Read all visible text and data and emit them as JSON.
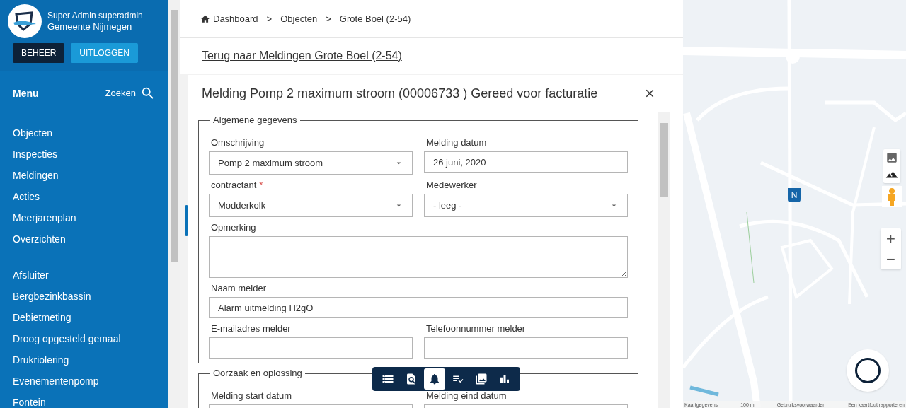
{
  "user": {
    "name": "Super Admin superadmin",
    "organisation": "Gemeente Nijmegen"
  },
  "header_buttons": [
    {
      "label": "BEHEER",
      "kind": "dark"
    },
    {
      "label": "UITLOGGEN",
      "kind": "light"
    }
  ],
  "menu": {
    "title": "Menu",
    "search_label": "Zoeken"
  },
  "nav_groups": [
    [
      "Objecten",
      "Inspecties",
      "Meldingen",
      "Acties",
      "Meerjarenplan",
      "Overzichten"
    ],
    [
      "Afsluiter",
      "Bergbezinkbassin",
      "Debietmeting",
      "Droog opgesteld gemaal",
      "Drukriolering",
      "Evenementenpomp",
      "Fontein"
    ]
  ],
  "breadcrumb": {
    "separator": ">",
    "items": [
      {
        "label": "Dashboard",
        "kind": "home-link"
      },
      {
        "label": "Objecten",
        "kind": "link"
      },
      {
        "label": "Grote Boel (2-54)",
        "kind": "current"
      }
    ]
  },
  "back_link": "Terug naar Meldingen Grote Boel (2-54)",
  "dialog": {
    "title": "Melding Pomp 2 maximum stroom (00006733 ) Gereed voor facturatie"
  },
  "sections": [
    {
      "legend": "Algemene gegevens",
      "fields": [
        {
          "label": "Omschrijving",
          "kind": "select",
          "value": "Pomp 2 maximum stroom",
          "wide": false
        },
        {
          "label": "Melding datum",
          "kind": "text",
          "value": "26 juni, 2020",
          "wide": false
        },
        {
          "label": "contractant",
          "required_mark": "*",
          "kind": "select",
          "value": "Modderkolk",
          "wide": false
        },
        {
          "label": "Medewerker",
          "kind": "select",
          "value": "- leeg -",
          "wide": false
        },
        {
          "label": "Opmerking",
          "kind": "textarea",
          "wide": true
        },
        {
          "label": "Naam melder",
          "kind": "text",
          "value": "Alarm uitmelding H2gO",
          "wide": true
        },
        {
          "label": "E-mailadres melder",
          "kind": "text",
          "wide": false
        },
        {
          "label": "Telefoonnummer melder",
          "kind": "text",
          "wide": false
        }
      ]
    },
    {
      "legend": "Oorzaak en oplossing",
      "fields": [
        {
          "label": "Melding start datum",
          "kind": "text",
          "wide": false
        },
        {
          "label": "Melding eind datum",
          "kind": "text",
          "wide": false
        }
      ]
    }
  ],
  "toolbar": [
    {
      "kind": "records",
      "selected": false
    },
    {
      "kind": "inspect",
      "selected": false
    },
    {
      "kind": "notifications",
      "selected": true
    },
    {
      "kind": "checklist",
      "selected": false
    },
    {
      "kind": "photos",
      "selected": false
    },
    {
      "kind": "chart",
      "selected": false
    }
  ],
  "map": {
    "marker_label": "N",
    "zoom_in": "+",
    "zoom_out": "−",
    "attribution": [
      "Kaartgegevens",
      "100 m",
      "Gebruiksvoorwaarden",
      "Een kaartfout rapporteren"
    ]
  }
}
